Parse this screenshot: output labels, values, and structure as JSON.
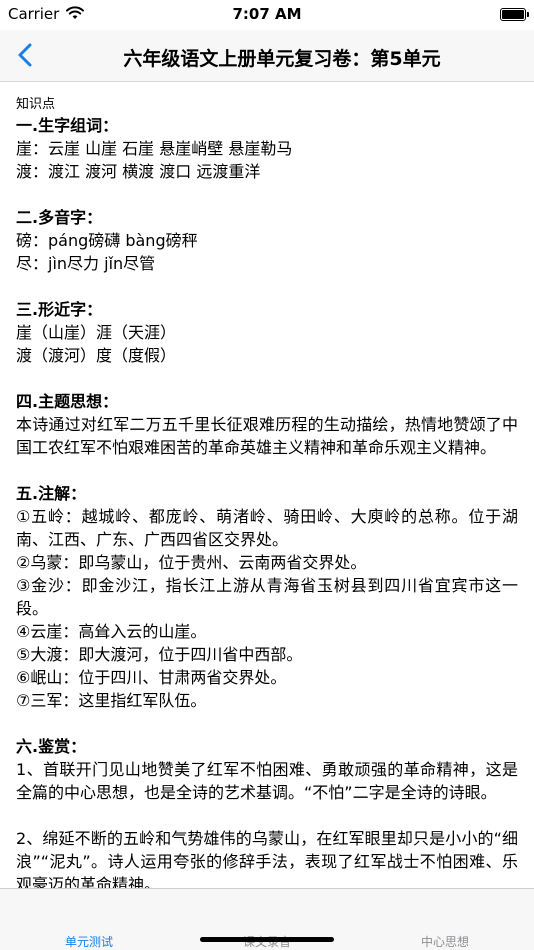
{
  "status_bar": {
    "carrier": "Carrier",
    "time": "7:07 AM",
    "wifi_icon": "wifi-icon",
    "battery_icon": "battery-icon"
  },
  "nav": {
    "back_icon": "chevron-left-icon",
    "title": "六年级语文上册单元复习卷：第5单元",
    "accent_color": "#1a7ee8"
  },
  "content": {
    "intro": "知识点",
    "sections": [
      {
        "title": "一.生字组词：",
        "lines": [
          "崖：云崖 山崖 石崖 悬崖峭壁 悬崖勒马",
          "渡：渡江 渡河 横渡 渡口 远渡重洋"
        ]
      },
      {
        "title": "二.多音字：",
        "lines": [
          "磅：páng磅礴 bàng磅秤",
          "尽：jìn尽力 jǐn尽管"
        ]
      },
      {
        "title": "三.形近字：",
        "lines": [
          "崖（山崖）涯（天涯）",
          "渡（渡河）度（度假）"
        ]
      },
      {
        "title": "四.主题思想：",
        "lines": [
          "本诗通过对红军二万五千里长征艰难历程的生动描绘，热情地赞颂了中国工农红军不怕艰难困苦的革命英雄主义精神和革命乐观主义精神。"
        ]
      },
      {
        "title": "五.注解：",
        "lines": [
          "①五岭：越城岭、都庞岭、萌渚岭、骑田岭、大庾岭的总称。位于湖南、江西、广东、广西四省区交界处。",
          "②乌蒙：即乌蒙山，位于贵州、云南两省交界处。",
          "③金沙：即金沙江，指长江上游从青海省玉树县到四川省宜宾市这一段。",
          "④云崖：高耸入云的山崖。",
          "⑤大渡：即大渡河，位于四川省中西部。",
          "⑥岷山：位于四川、甘肃两省交界处。",
          "⑦三军：这里指红军队伍。"
        ]
      },
      {
        "title": "六.鉴赏：",
        "lines": [
          "1、首联开门见山地赞美了红军不怕困难、勇敢顽强的革命精神，这是全篇的中心思想，也是全诗的艺术基调。“不怕”二字是全诗的诗眼。",
          "2、绵延不断的五岭和气势雄伟的乌蒙山，在红军眼里却只是小小的“细浪”“泥丸”。诗人运用夸张的修辞手法，表现了红军战士不怕困难、乐观豪迈的革命精神。"
        ]
      }
    ]
  },
  "tabs": [
    {
      "label": "单元测试",
      "active": true
    },
    {
      "label": "课文录音",
      "active": false
    },
    {
      "label": "中心思想",
      "active": false
    }
  ]
}
